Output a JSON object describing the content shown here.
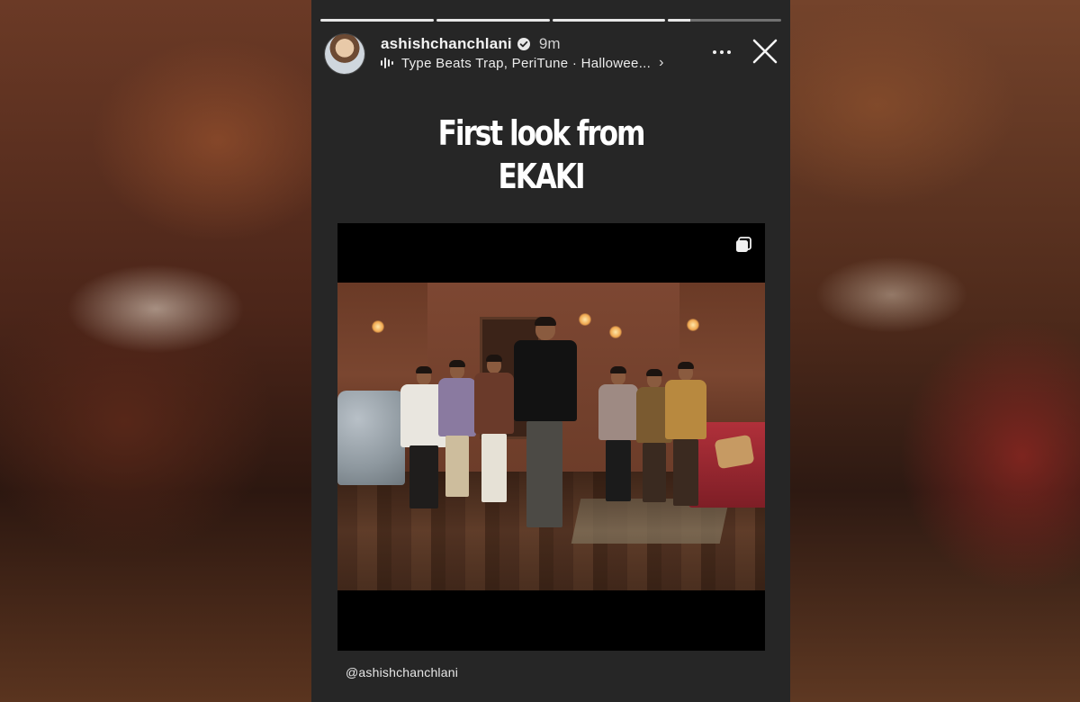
{
  "story": {
    "progress_segments": [
      1,
      1,
      1,
      0.2
    ],
    "user": {
      "username": "ashishchanchlani",
      "verified": true,
      "time_ago": "9m"
    },
    "music": {
      "text": "Type Beats Trap, PeriTune · Hallowee...",
      "icon": "audio-bars-icon"
    },
    "headline": {
      "line1": "First look from",
      "line2": "EKAKI"
    },
    "media": {
      "multi_icon": "carousel-icon"
    },
    "mention": "@ashishchanchlani",
    "icons": {
      "more": "more-dots-icon",
      "close": "close-icon",
      "verified": "verified-badge-icon"
    }
  },
  "colors": {
    "panel": "#262626",
    "text": "#ffffff"
  }
}
